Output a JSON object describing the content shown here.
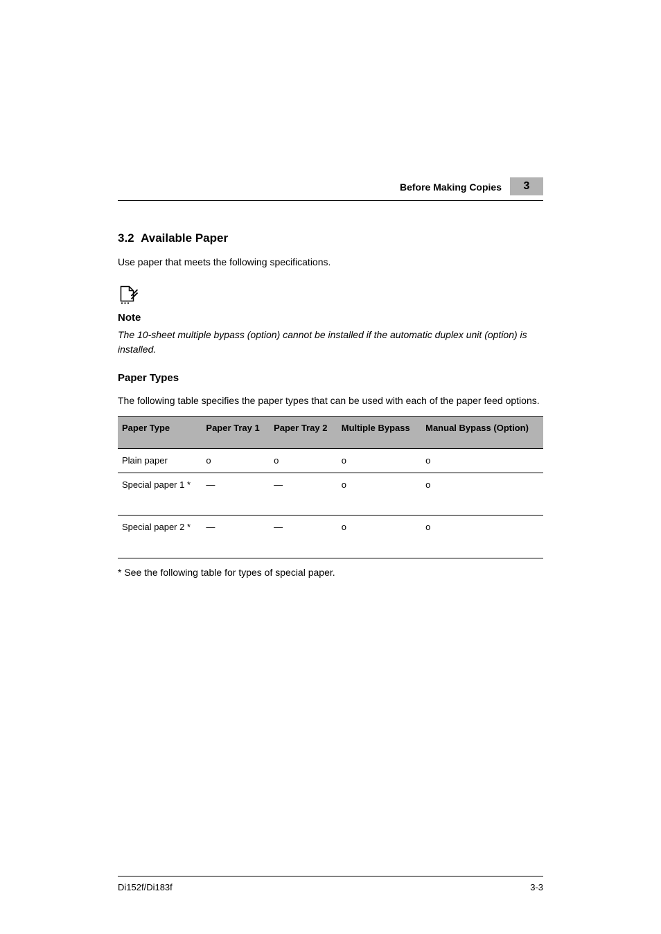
{
  "header": {
    "title": "Before Making Copies",
    "chapter": "3"
  },
  "section": {
    "number": "3.2",
    "title": "Available Paper"
  },
  "intro": "Use paper that meets the following specifications.",
  "note": {
    "title": "Note",
    "text": "The 10-sheet multiple bypass (option) cannot be installed if the automatic duplex unit (option) is installed."
  },
  "subsection": {
    "title": "Paper Types"
  },
  "table_intro": "The following table specifies the paper types that can be used with each of the paper feed options.",
  "table": {
    "headers": [
      "Paper Type",
      "Paper Tray 1",
      "Paper Tray 2",
      "Multiple Bypass",
      "Manual Bypass (Option)"
    ],
    "rows": [
      {
        "cells": [
          "Plain paper",
          "o",
          "o",
          "o",
          "o"
        ],
        "tall": false
      },
      {
        "cells": [
          "Special paper 1 *",
          "—",
          "—",
          "o",
          "o"
        ],
        "tall": true
      },
      {
        "cells": [
          "Special paper 2 *",
          "—",
          "—",
          "o",
          "o"
        ],
        "tall": true
      }
    ]
  },
  "footnote": "* See the following table for types of special paper.",
  "footer": {
    "left": "Di152f/Di183f",
    "right": "3-3"
  }
}
